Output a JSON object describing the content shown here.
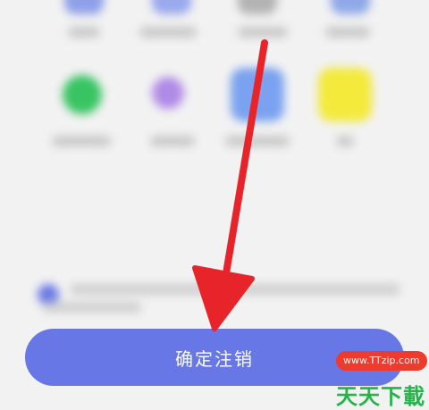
{
  "confirm_button": {
    "label": "确定注销"
  },
  "watermark": {
    "url": "www.TTzip.com",
    "text": "天天下載"
  },
  "colors": {
    "button": "#6877e6",
    "arrow": "#e8242b",
    "watermark_green": "#26b34a",
    "watermark_red": "#ee3b2e"
  }
}
